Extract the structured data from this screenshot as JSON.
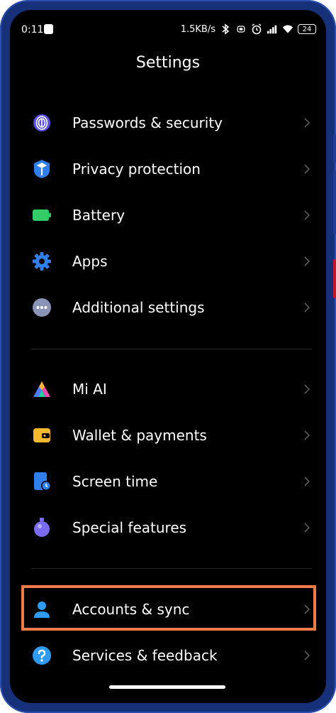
{
  "status_bar": {
    "time": "0:11",
    "net_speed": "1.5KB/s",
    "battery_level": "24",
    "icons": [
      "notification-icon",
      "bluetooth-icon",
      "vibrate-icon",
      "alarm-icon",
      "signal-icon",
      "wifi-icon",
      "battery-icon"
    ]
  },
  "header": {
    "title": "Settings"
  },
  "sections": [
    {
      "items": [
        {
          "label": "Passwords & security",
          "icon": "fingerprint-icon",
          "color": "#7b6cff"
        },
        {
          "label": "Privacy protection",
          "icon": "shield-icon",
          "color": "#2f80ed"
        },
        {
          "label": "Battery",
          "icon": "battery-icon",
          "color": "#33cc66"
        },
        {
          "label": "Apps",
          "icon": "gear-icon",
          "color": "#2f80ed"
        },
        {
          "label": "Additional settings",
          "icon": "more-dots-icon",
          "color": "#8a93b8"
        }
      ]
    },
    {
      "items": [
        {
          "label": "Mi AI",
          "icon": "mi-ai-icon",
          "color": "#6a5cff"
        },
        {
          "label": "Wallet & payments",
          "icon": "wallet-icon",
          "color": "#f5b930"
        },
        {
          "label": "Screen time",
          "icon": "screen-time-icon",
          "color": "#2f80ed"
        },
        {
          "label": "Special features",
          "icon": "special-features-icon",
          "color": "#7a6cf0"
        }
      ]
    },
    {
      "items": [
        {
          "label": "Accounts & sync",
          "icon": "account-icon",
          "color": "#2f9bf0",
          "highlighted": true
        },
        {
          "label": "Services & feedback",
          "icon": "help-icon",
          "color": "#2f9bf0"
        }
      ]
    }
  ],
  "colors": {
    "background": "#000000",
    "text": "#ffffff",
    "chevron": "#5a5a5a",
    "highlight_border": "#f37a4a",
    "device_frame": "#16317a"
  }
}
